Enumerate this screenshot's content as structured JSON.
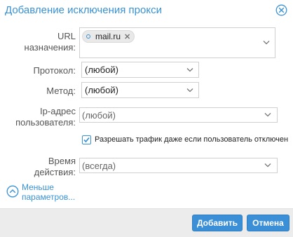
{
  "dialog": {
    "title": "Добавление исключения прокси",
    "close_icon": "close-circle-icon"
  },
  "form": {
    "url": {
      "label_line1": "URL",
      "label_line2": "назначения:",
      "tags": [
        "mail.ru"
      ]
    },
    "protocol": {
      "label": "Протокол:",
      "value": "(любой)"
    },
    "method": {
      "label": "Метод:",
      "value": "(любой)"
    },
    "user_ip": {
      "label_line1": "Ip-адрес",
      "label_line2": "пользователя:",
      "value": "(любой)"
    },
    "allow_traffic": {
      "label": "Разрешать трафик даже если пользователь отключен",
      "checked": true
    },
    "time": {
      "label_line1": "Время",
      "label_line2": "действия:",
      "value": "(всегда)"
    },
    "less_params": {
      "line1": "Меньше",
      "line2": "параметров..."
    }
  },
  "footer": {
    "add_label": "Добавить",
    "cancel_label": "Отмена"
  },
  "colors": {
    "accent": "#3892d4",
    "button": "#3b8fd6",
    "footer_bg": "#ececec"
  }
}
